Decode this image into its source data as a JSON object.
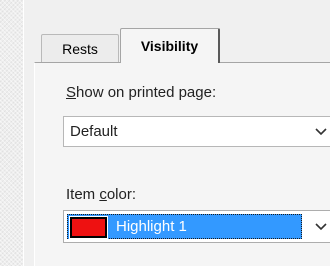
{
  "tabs": {
    "rests_label": "Rests",
    "visibility_label": "Visibility"
  },
  "show_on_printed_page": {
    "label_accel": "S",
    "label_rest": "how on printed page:",
    "selected": "Default"
  },
  "item_color": {
    "label_pre": "Item ",
    "label_accel": "c",
    "label_rest": "olor:",
    "selected": "Highlight 1",
    "swatch_color": "#ee1111",
    "selection_color": "#3399ff"
  }
}
